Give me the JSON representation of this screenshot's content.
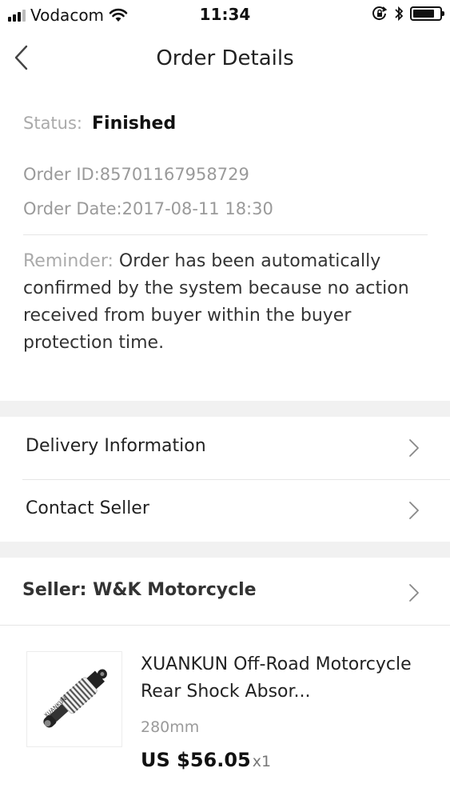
{
  "status_bar": {
    "carrier": "Vodacom",
    "time": "11:34",
    "battery_level": 0.8
  },
  "nav": {
    "title": "Order Details"
  },
  "order": {
    "status_label": "Status:",
    "status_value": "Finished",
    "order_id": "Order ID:85701167958729",
    "order_date": "Order Date:2017-08-11 18:30",
    "reminder_label": "Reminder:",
    "reminder_text": " Order has been automatically confirmed by the system because no action received from buyer within the buyer protection time."
  },
  "menu": {
    "delivery_label": "Delivery Information",
    "contact_label": "Contact Seller"
  },
  "seller": {
    "label": "Seller: W&K Motorcycle"
  },
  "product": {
    "title": "XUANKUN  Off-Road Motorcycle Rear Shock Absor...",
    "variant": "280mm",
    "price": "US $56.05",
    "quantity": "x1",
    "thumb_brand": "XUANKUN"
  }
}
